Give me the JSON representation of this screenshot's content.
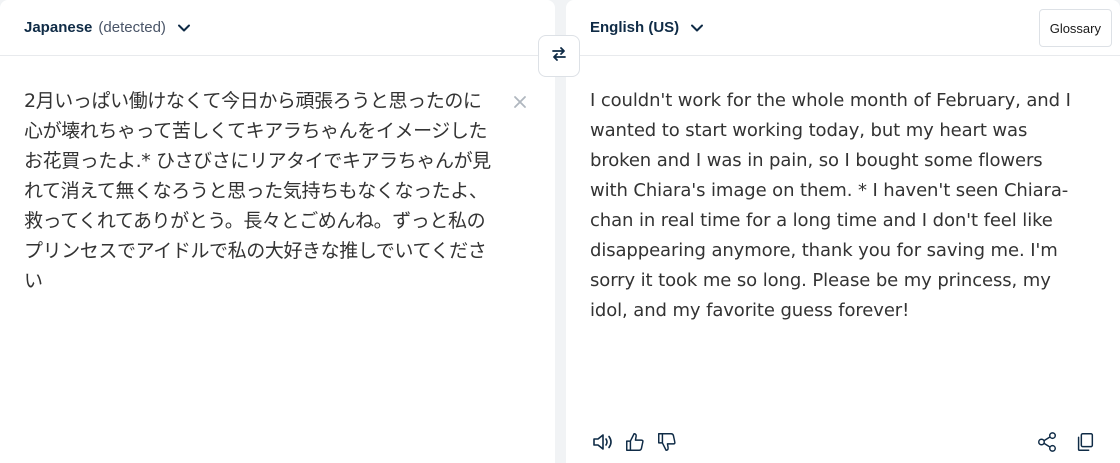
{
  "source": {
    "language_name": "Japanese",
    "language_detected": "(detected)",
    "text": "2月いっぱい働けなくて今日から頑張ろうと思ったのに心が壊れちゃって苦しくてキアラちゃんをイメージしたお花買ったよ.* ひさびさにリアタイでキアラちゃんが見れて消えて無くなろうと思った気持ちもなくなったよ、救ってくれてありがとう。長々とごめんね。ずっと私のプリンセスでアイドルで私の大好きな推しでいてください"
  },
  "target": {
    "language_name": "English (US)",
    "glossary_label": "Glossary",
    "text": "I couldn't work for the whole month of February, and I wanted to start working today, but my heart was broken and I was in pain, so I bought some flowers with Chiara's image on them. * I haven't seen Chiara-chan in real time for a long time and I don't feel like disappearing anymore, thank you for saving me. I'm sorry it took me so long. Please be my princess, my idol, and my favorite guess forever!"
  },
  "icons": {
    "swap": "swap-arrows-icon",
    "clear": "close-icon",
    "chevron": "chevron-down-icon",
    "speaker": "speaker-icon",
    "thumbs_up": "thumbs-up-icon",
    "thumbs_down": "thumbs-down-icon",
    "share": "share-icon",
    "copy": "copy-icon"
  },
  "colors": {
    "background": "#f1f3f5",
    "panel": "#ffffff",
    "language_text": "#0f2b46",
    "body_text": "#333333",
    "icon": "#0f2b46"
  }
}
